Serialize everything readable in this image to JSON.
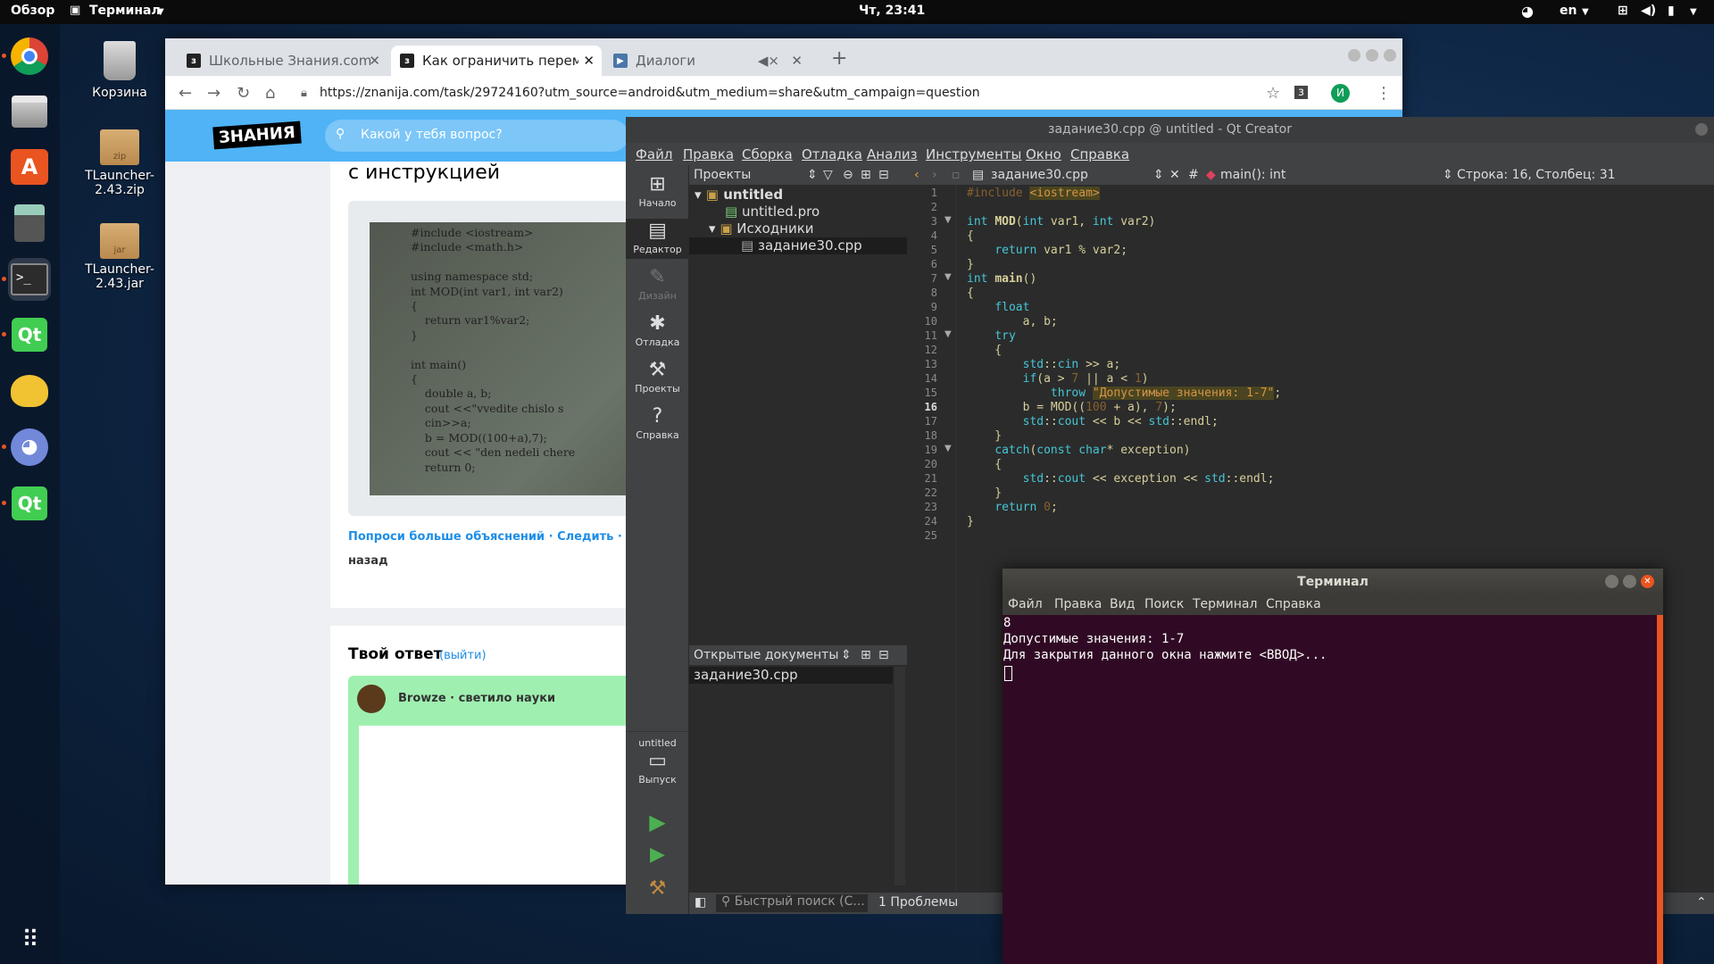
{
  "topbar": {
    "activities": "Обзор",
    "app": "Терминал",
    "clock": "Чт, 23:41",
    "lang": "en"
  },
  "desktop": {
    "trash": "Корзина",
    "file1": "TLauncher-2.43.zip",
    "file1_badge": "zip",
    "file2": "TLauncher-2.43.jar",
    "file2_badge": "jar"
  },
  "browser": {
    "tabs": [
      {
        "label": "Школьные Знания.com"
      },
      {
        "label": "Как ограничить перемен"
      },
      {
        "label": "Диалоги"
      }
    ],
    "url": "https://znanija.com/task/29724160?utm_source=android&utm_medium=share&utm_campaign=question",
    "avatar": "И",
    "logo": "ЗНАНИЯ",
    "search_placeholder": "Какой у тебя вопрос?",
    "heading": "с инструкцией",
    "photo_code": [
      "#include <iostream>",
      "#include <math.h>",
      "",
      "using namespace std;",
      "int MOD(int var1, int var2)",
      "{",
      "    return var1%var2;",
      "}",
      "",
      "int main()",
      "{",
      "    double a, b;",
      "    cout <<\"vvedite chislo s",
      "    cin>>a;",
      "    b = MOD((100+a),7);",
      "    cout << \"den nedeli chere",
      "    return 0;"
    ],
    "actions": "Попроси больше объяснений · Следить · Отмет",
    "back": "назад",
    "answer_title": "Твой ответ",
    "logout": "(выйти)",
    "user": "Browze · светило науки"
  },
  "qt": {
    "title": "задание30.cpp @ untitled - Qt Creator",
    "menu": [
      "Файл",
      "Правка",
      "Сборка",
      "Отладка",
      "Анализ",
      "Инструменты",
      "Окно",
      "Справка"
    ],
    "modes": [
      "Начало",
      "Редактор",
      "Дизайн",
      "Отладка",
      "Проекты",
      "Справка"
    ],
    "projects_label": "Проекты",
    "tree": {
      "root": "untitled",
      "pro": "untitled.pro",
      "sources": "Исходники",
      "file": "задание30.cpp"
    },
    "open_docs_label": "Открытые документы",
    "open_doc": "задание30.cpp",
    "kit": "untitled",
    "build_mode": "Выпуск",
    "editor_file": "задание30.cpp",
    "symbol": "main(): int",
    "position": "Строка: 16, Столбец: 31",
    "quick_search": "Быстрый поиск (С...",
    "problems": "1 Проблемы",
    "line_numbers": [
      "1",
      "2",
      "3",
      "4",
      "5",
      "6",
      "7",
      "8",
      "9",
      "10",
      "11",
      "12",
      "13",
      "14",
      "15",
      "16",
      "17",
      "18",
      "19",
      "20",
      "21",
      "22",
      "23",
      "24",
      "25"
    ],
    "code": {
      "l1a": "#include ",
      "l1b": "<iostream>",
      "l3": "int MOD(int var1, int var2)",
      "l4": "{",
      "l5": "    return var1 % var2;",
      "l6": "}",
      "l7": "int main()",
      "l8": "{",
      "l9": "    float",
      "l10": "        a, b;",
      "l11": "    try",
      "l12": "    {",
      "l13": "        std::cin >> a;",
      "l14": "        if(a > 7 || a < 1)",
      "l15a": "            throw ",
      "l15b": "\"Допустимые значения: 1-7\"",
      "l15c": ";",
      "l16": "        b = MOD((100 + a), 7);",
      "l17": "        std::cout << b << std::endl;",
      "l18": "    }",
      "l19": "    catch(const char* exception)",
      "l20": "    {",
      "l21": "        std::cout << exception << std::endl;",
      "l22": "    }",
      "l23": "    return 0;",
      "l24": "}"
    }
  },
  "terminal": {
    "title": "Терминал",
    "menu": [
      "Файл",
      "Правка",
      "Вид",
      "Поиск",
      "Терминал",
      "Справка"
    ],
    "lines": [
      "8",
      "Допустимые значения: 1-7",
      "Для закрытия данного окна нажмите <ВВОД>..."
    ]
  }
}
